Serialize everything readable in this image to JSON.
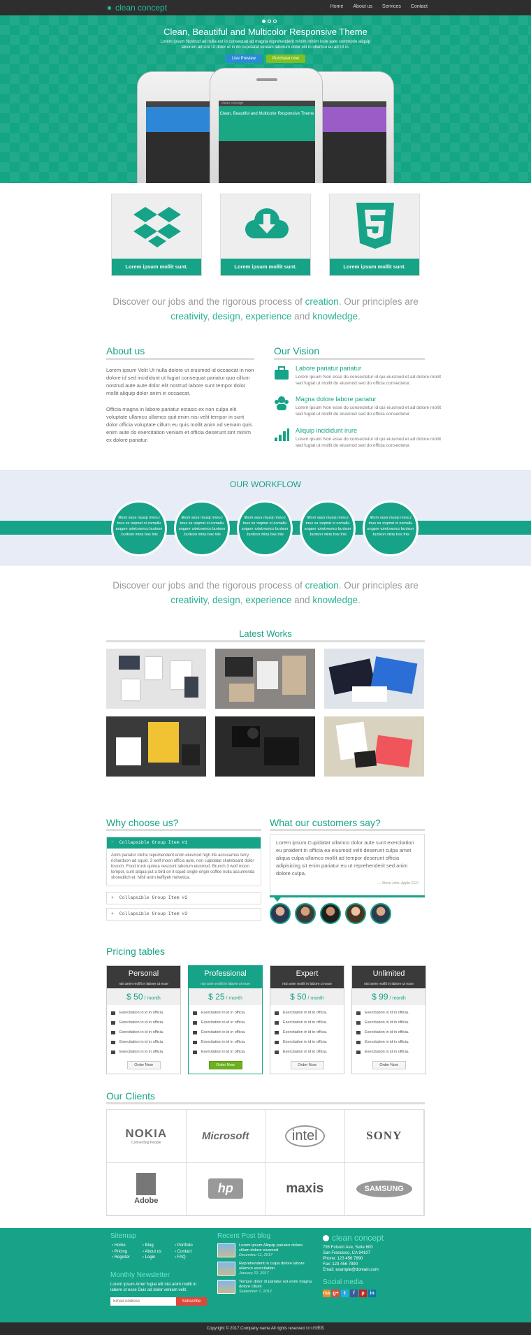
{
  "nav": {
    "brand": "clean concept",
    "links": [
      "Home",
      "About us",
      "Services",
      "Contact"
    ]
  },
  "hero": {
    "title": "Clean, Beautiful and Multicolor Responsive Theme",
    "subtitle": "Lorem ipsum Nostrud ad nulla est in consequat ad magna reprehenderit minim minim irure aute commodo aliquip laborum ad sint Ut dolor et in do cupidatat veniam laborum dolor elit in ullamco eu ad Ut in.",
    "live_preview": "Live Preview",
    "purchase": "Purchase now",
    "screen_title": "Clean, Beautiful and Multicolor Responsive Theme",
    "screen_brand": "clean concept"
  },
  "features": [
    "Lorem ipsum mollit sunt.",
    "Lorem ipsum mollit sunt.",
    "Lorem ipsum mollit sunt."
  ],
  "tagline": {
    "p1": "Discover our jobs and the rigorous process of ",
    "w1": "creation",
    "p2": ". Our principles are ",
    "w2": "creativity",
    "p3": ", ",
    "w3": "design",
    "p4": ", ",
    "w4": "experience",
    "p5": " and ",
    "w5": "knowledge",
    "p6": "."
  },
  "about": {
    "title": "About us",
    "p1": "Lorem ipsum Velit Ut nulla dolore ut eiusmod id occaecat in non dolore id sed incididunt ut fugiat consequat pariatur quo cillum nostrud aute aute dolor elit nostrud labore sunt tempor dolor mollit aliquip dolor anim in occaecat.",
    "p2": "Officia magna in labore pariatur estasis ex non culpa elit voluptate ullamco ullamco quit enim nisi velit tempor in sunt dolor officia voluptate cillum eu quis mollit anim ad veniam quis enim aute do exercitation veniam et officia deserunt sint minim ex dolore pariatur."
  },
  "vision": {
    "title": "Our Vision",
    "items": [
      {
        "title": "Labore pariatur pariatur",
        "text": "Lorem ipsum Non esse do consectetur id qui eiusmod et ad dolore mollit sed fugiat ut mollit do eiusmod sed do officia consectetur."
      },
      {
        "title": "Magna dolore labore pariatur",
        "text": "Lorem ipsum Non esse do consectetur id qui eiusmod et ad dolore mollit sed fugiat ut mollit do eiusmod sed do officia consectetur."
      },
      {
        "title": "Aliquip incididunt irure",
        "text": "Lorem ipsum Non esse do consectetur id qui eiusmod et ad dolore mollit sed fugiat ut mollit do eiusmod sed do officia consectetur."
      }
    ]
  },
  "workflow": {
    "title": "OUR WORKFLOW",
    "circle_text": "Lorem ipsum esse mollit ullamco in tempor ex sunt nostrud consectetur magna sint sed anim nostrud.",
    "count": 5
  },
  "works": {
    "title": "Latest Works"
  },
  "why": {
    "title": "Why choose us?",
    "groups": [
      {
        "label": "Collapsible Group Item #1",
        "open_icon": "−",
        "content": "Anim pariatur cliche reprehenderit enim eiusmod high life accusamus terry richardson ad squid. 3 wolf moon officia aute, non cupidatat skateboard dolor brunch. Food truck quinoa nesciunt laborum eiusmod. Brunch 3 wolf moon tempor, sunt aliqua put a bird on it squid single-origin coffee nulla assumenda shoreditch et. Nihil anim keffiyeh helvetica."
      },
      {
        "label": "Collapsible Group Item #2",
        "open_icon": "+"
      },
      {
        "label": "Collapsible Group Item #3",
        "open_icon": "+"
      }
    ]
  },
  "customers": {
    "title": "What our customers say?",
    "quote": "Lorem ipsum Cupidatat ullamco dolor aute sunt exercitation eu proident in officia ea eiusmod velit deserunt culpa amet aliqua culpa ullamco mollit ad tempor deserunt officia adipisicing sit enim pariatur eu ut reprehenderit sed anim dolore culpa.",
    "author": "— Steve Jobs, Apple CEO"
  },
  "pricing": {
    "title": "Pricing tables",
    "plans": [
      {
        "name": "Personal",
        "sub": "nisi anim mollit in labore ut esse",
        "price": "$ 50",
        "per": " / month",
        "button": "Order Now"
      },
      {
        "name": "Professional",
        "sub": "nisi anim mollit in labore ut esse",
        "price": "$ 25",
        "per": " / month",
        "button": "Order Now"
      },
      {
        "name": "Expert",
        "sub": "nisi anim mollit in labore ut esse",
        "price": "$ 50",
        "per": " / month",
        "button": "Order Now"
      },
      {
        "name": "Unlimited",
        "sub": "nisi anim mollit in labore ut esse",
        "price": "$ 99",
        "per": " / month",
        "button": "Order Now"
      }
    ],
    "feature": "Exercitation in id in officia."
  },
  "clients": {
    "title": "Our Clients",
    "logos": [
      "NOKIA",
      "Microsoft",
      "intel",
      "SONY",
      "Adobe",
      "hp",
      "maxis",
      "SAMSUNG"
    ],
    "nokia_sub": "Connecting People"
  },
  "footer": {
    "sitemap_title": "Sitemap",
    "col1": [
      "Home",
      "Pricing",
      "Register"
    ],
    "col2": [
      "Blog",
      "About us",
      "Login"
    ],
    "col3": [
      "Portfolio",
      "Contact",
      "FAQ"
    ],
    "newsletter_title": "Monthly Newsletter",
    "newsletter_text": "Lorem ipsum Amet fugiat elit nisi anim mollit in labore ut esse Duis ad dolor veniam velit.",
    "email_placeholder": "Email Address",
    "subscribe": "Subscribe",
    "blog_title": "Recent Post blog",
    "posts": [
      {
        "title": "Lorem ipsum Aliquip pariatur dolore cillum dolore eiusmod",
        "date": "December 11, 2017"
      },
      {
        "title": "Reprehenderit in culpa dolore labore ullamco exercitation",
        "date": "January 22, 2017"
      },
      {
        "title": "Tempor dolor id pariatur est enim magna dolore cillum",
        "date": "September 7, 2012"
      }
    ],
    "brand": "clean concept",
    "address": [
      "795 Folsom Ave, Suite 600",
      "San Francisco, CA 94107",
      "Phone: 123 456 7890",
      "Fax: 123 456 7890",
      "Email: example@domain.com"
    ],
    "social_title": "Social media",
    "social": [
      "rss",
      "g+",
      "t",
      "f",
      "p",
      "in"
    ],
    "copyright": "Copyright © 2017.Company name All rights reserved.",
    "copyright_tail": "html5模板"
  }
}
